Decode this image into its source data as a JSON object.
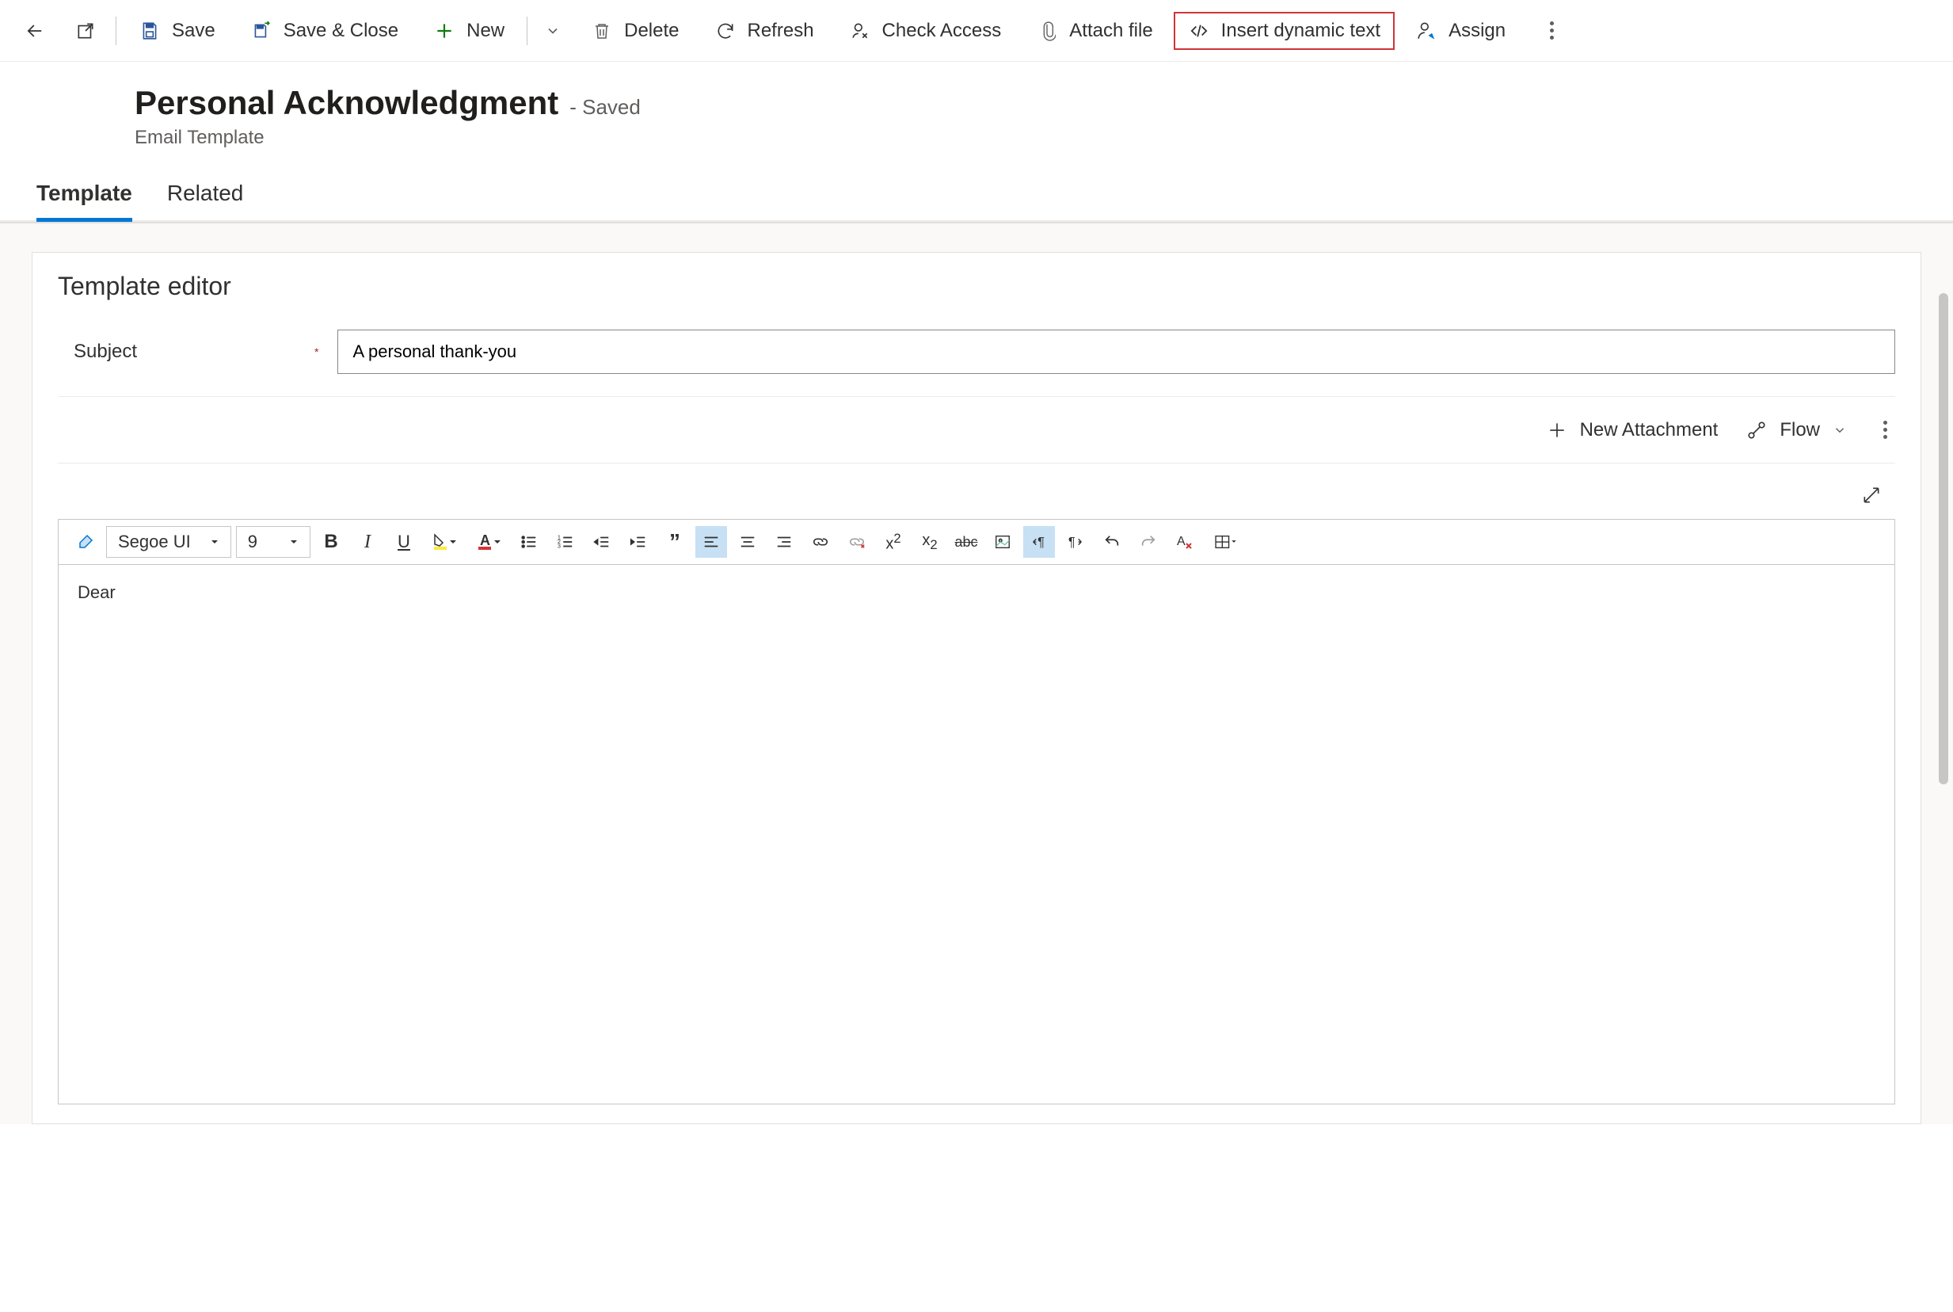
{
  "commandBar": {
    "save": "Save",
    "saveClose": "Save & Close",
    "new": "New",
    "delete": "Delete",
    "refresh": "Refresh",
    "checkAccess": "Check Access",
    "attachFile": "Attach file",
    "insertDynamic": "Insert dynamic text",
    "assign": "Assign"
  },
  "header": {
    "title": "Personal Acknowledgment",
    "status": "- Saved",
    "entityType": "Email Template"
  },
  "tabs": {
    "template": "Template",
    "related": "Related"
  },
  "editor": {
    "sectionTitle": "Template editor",
    "subjectLabel": "Subject",
    "subjectValue": "A personal thank-you",
    "newAttachment": "New Attachment",
    "flow": "Flow",
    "fontName": "Segoe UI",
    "fontSize": "9",
    "bodyText": "Dear"
  }
}
